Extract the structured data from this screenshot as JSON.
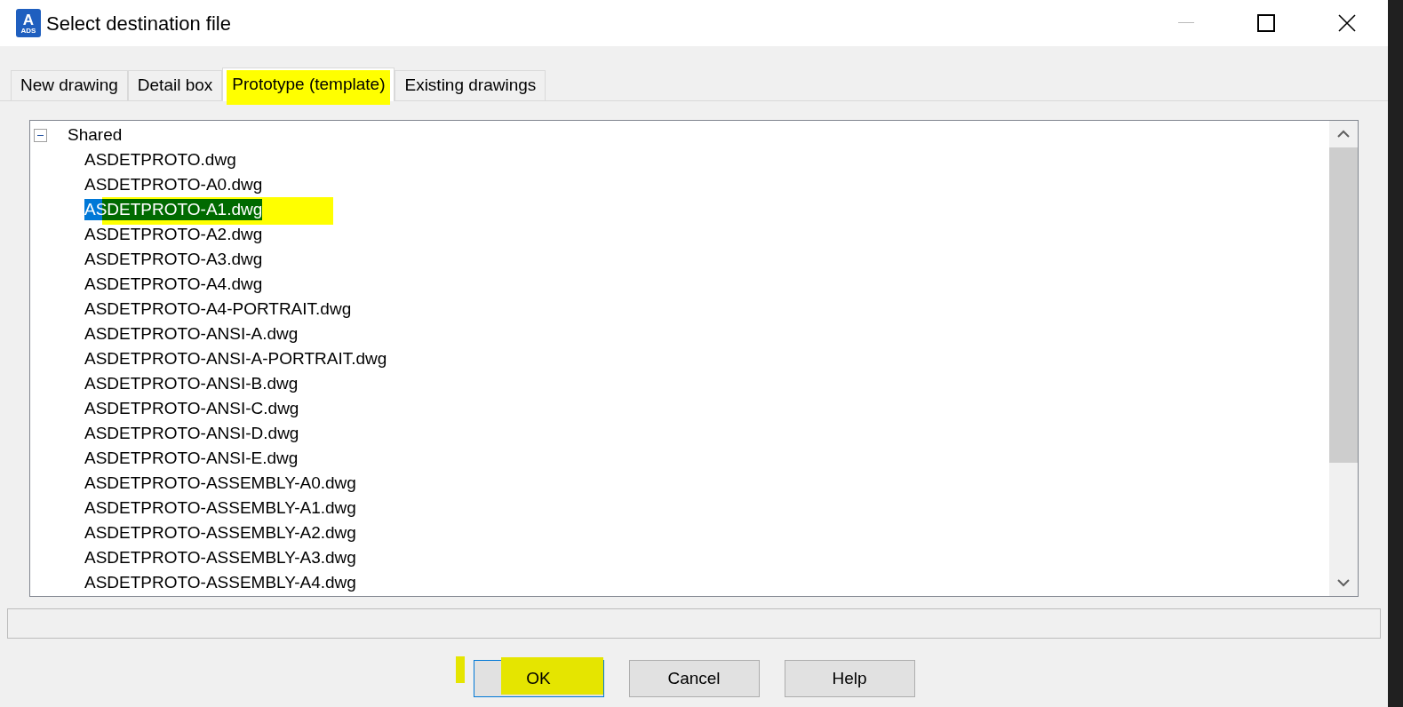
{
  "window": {
    "title": "Select destination file",
    "app_icon": {
      "letter": "A",
      "caption": "ADS"
    }
  },
  "tabs": [
    {
      "label": "New drawing",
      "selected": false
    },
    {
      "label": "Detail box",
      "selected": false
    },
    {
      "label": "Prototype (template)",
      "selected": true
    },
    {
      "label": "Existing drawings",
      "selected": false
    }
  ],
  "tree": {
    "label": "Shared",
    "expanded": true,
    "children": [
      {
        "label": "ASDETPROTO.dwg",
        "selected": false
      },
      {
        "label": "ASDETPROTO-A0.dwg",
        "selected": false
      },
      {
        "label": "ASDETPROTO-A1.dwg",
        "selected": true
      },
      {
        "label": "ASDETPROTO-A2.dwg",
        "selected": false
      },
      {
        "label": "ASDETPROTO-A3.dwg",
        "selected": false
      },
      {
        "label": "ASDETPROTO-A4.dwg",
        "selected": false
      },
      {
        "label": "ASDETPROTO-A4-PORTRAIT.dwg",
        "selected": false
      },
      {
        "label": "ASDETPROTO-ANSI-A.dwg",
        "selected": false
      },
      {
        "label": "ASDETPROTO-ANSI-A-PORTRAIT.dwg",
        "selected": false
      },
      {
        "label": "ASDETPROTO-ANSI-B.dwg",
        "selected": false
      },
      {
        "label": "ASDETPROTO-ANSI-C.dwg",
        "selected": false
      },
      {
        "label": "ASDETPROTO-ANSI-D.dwg",
        "selected": false
      },
      {
        "label": "ASDETPROTO-ANSI-E.dwg",
        "selected": false
      },
      {
        "label": "ASDETPROTO-ASSEMBLY-A0.dwg",
        "selected": false
      },
      {
        "label": "ASDETPROTO-ASSEMBLY-A1.dwg",
        "selected": false
      },
      {
        "label": "ASDETPROTO-ASSEMBLY-A2.dwg",
        "selected": false
      },
      {
        "label": "ASDETPROTO-ASSEMBLY-A3.dwg",
        "selected": false
      },
      {
        "label": "ASDETPROTO-ASSEMBLY-A4.dwg",
        "selected": false
      }
    ]
  },
  "buttons": [
    {
      "label": "OK",
      "default": true
    },
    {
      "label": "Cancel",
      "default": false
    },
    {
      "label": "Help",
      "default": false
    }
  ]
}
